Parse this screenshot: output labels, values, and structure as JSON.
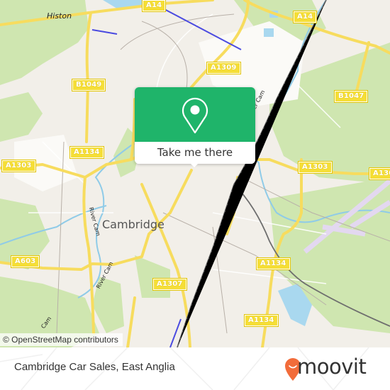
{
  "map": {
    "place_labels": {
      "histon": "Histon",
      "cambridge": "Cambridge"
    },
    "road_labels": [
      {
        "id": "a14-west",
        "text": "A14"
      },
      {
        "id": "a14-east",
        "text": "A14"
      },
      {
        "id": "a1309",
        "text": "A1309"
      },
      {
        "id": "b1049",
        "text": "B1049"
      },
      {
        "id": "b1047",
        "text": "B1047"
      },
      {
        "id": "a1134-north",
        "text": "A1134"
      },
      {
        "id": "a1303-west",
        "text": "A1303"
      },
      {
        "id": "a1303-east",
        "text": "A1303"
      },
      {
        "id": "a1303-far-east",
        "text": "A130"
      },
      {
        "id": "a603",
        "text": "A603"
      },
      {
        "id": "a1307",
        "text": "A1307"
      },
      {
        "id": "a1134-east",
        "text": "A1134"
      },
      {
        "id": "a1134-south",
        "text": "A1134"
      }
    ],
    "river_labels": {
      "river_cam_1": "River Cam",
      "river_cam_2": "River Cam",
      "river_cam_3": "River Cam",
      "river_cam_4": "Cam"
    },
    "colors": {
      "background": "#f2efe9",
      "park": "#c8e6a5",
      "water": "#a9d8ef",
      "road": "#f7dc5e",
      "rail": "#707070",
      "busway": "#4a4ae0",
      "runway": "#e3d8f0",
      "accent": "#1fb46a"
    }
  },
  "popup": {
    "icon": "map-pin-icon",
    "button_label": "Take me there"
  },
  "attribution": "© OpenStreetMap contributors",
  "footer": {
    "title": "Cambridge Car Sales, East Anglia",
    "brand": "moovit",
    "brand_color": "#f26c3a"
  }
}
